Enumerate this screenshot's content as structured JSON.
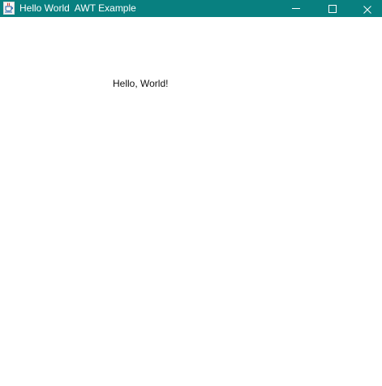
{
  "window": {
    "title": "Hello World  AWT Example",
    "titlebar_color": "#088080",
    "app_icon": "java-cup-icon",
    "controls": {
      "minimize": "minimize-icon",
      "maximize": "maximize-icon",
      "close": "close-icon"
    }
  },
  "content": {
    "label_text": "Hello, World!"
  },
  "colors": {
    "titlebar_bg": "#088080",
    "titlebar_text": "#ffffff",
    "client_bg": "#ffffff",
    "label_text": "#111111"
  }
}
